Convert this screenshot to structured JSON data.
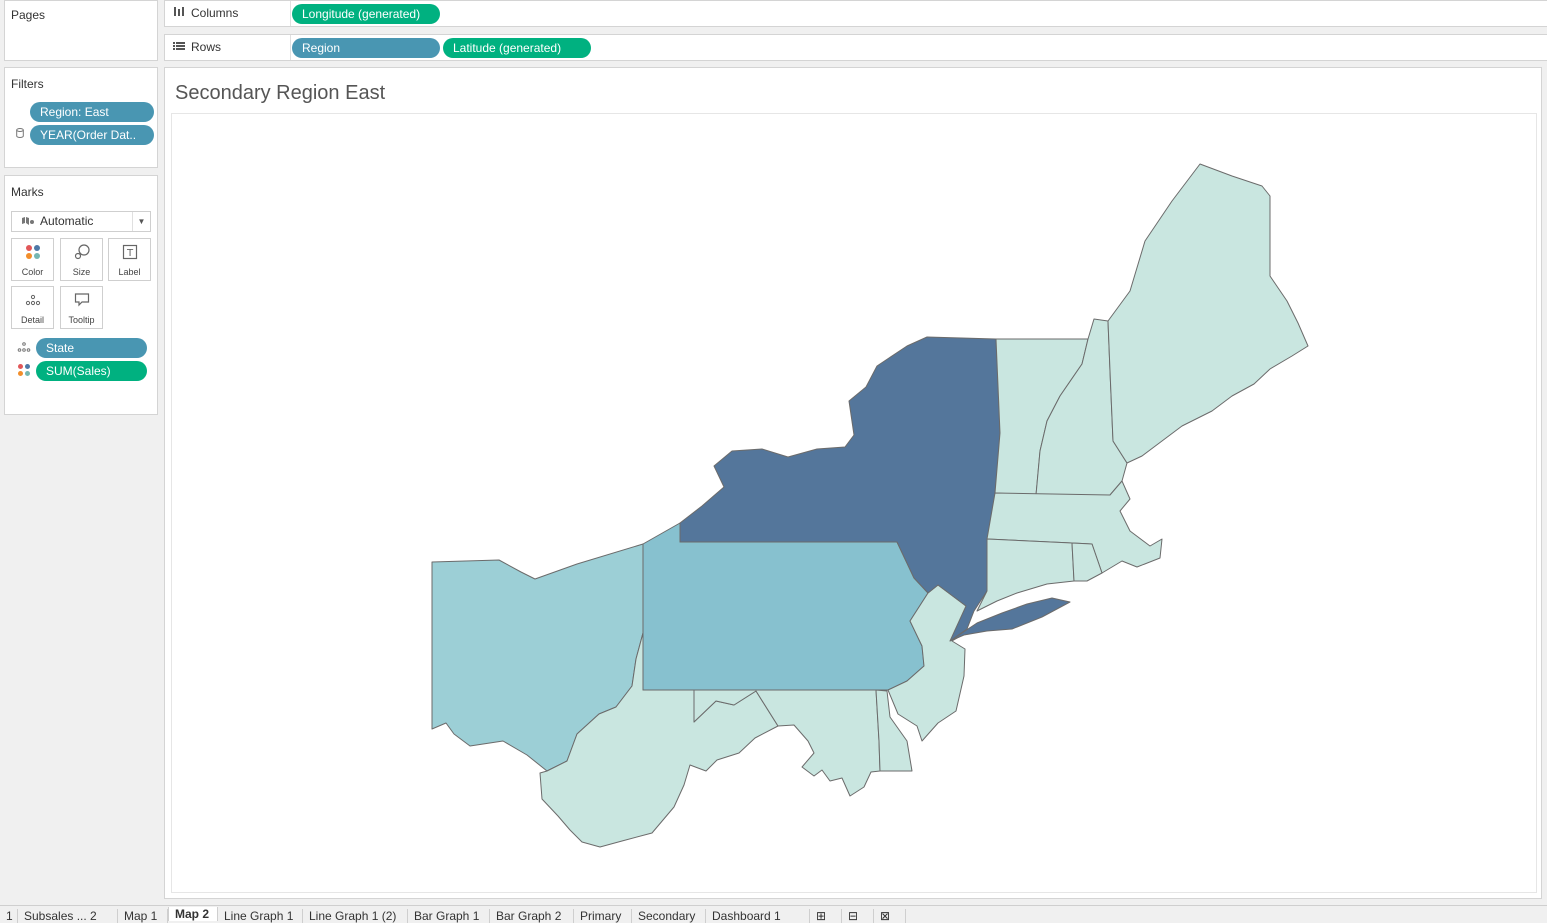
{
  "pages_panel": {
    "title": "Pages"
  },
  "filters_panel": {
    "title": "Filters",
    "items": [
      {
        "label": "Region: East",
        "color": "#4996b2"
      },
      {
        "label": "YEAR(Order Dat..",
        "color": "#4996b2"
      }
    ]
  },
  "marks_panel": {
    "title": "Marks",
    "mark_type": "Automatic",
    "buttons": [
      "Color",
      "Size",
      "Label",
      "Detail",
      "Tooltip"
    ],
    "fields": [
      {
        "label": "State",
        "role": "detail-icon",
        "color": "#4996b2"
      },
      {
        "label": "SUM(Sales)",
        "role": "color-icon",
        "color": "#00b180"
      }
    ]
  },
  "columns_shelf": {
    "label": "Columns",
    "pills": [
      "Longitude (generated)"
    ]
  },
  "rows_shelf": {
    "label": "Rows",
    "pills": [
      "Region",
      "Latitude (generated)"
    ]
  },
  "view": {
    "title": "Secondary Region East"
  },
  "map": {
    "color_scale": {
      "low": "#c9e6e0",
      "mid": "#87c1cf",
      "high": "#54769b"
    },
    "states": [
      {
        "code": "NY",
        "shade": "high"
      },
      {
        "code": "PA",
        "shade": "mid"
      },
      {
        "code": "OH",
        "shade": "mid-low"
      },
      {
        "code": "NJ",
        "shade": "low"
      },
      {
        "code": "WV",
        "shade": "low"
      },
      {
        "code": "MD",
        "shade": "low"
      },
      {
        "code": "DE",
        "shade": "low"
      },
      {
        "code": "VT",
        "shade": "low"
      },
      {
        "code": "NH",
        "shade": "low"
      },
      {
        "code": "ME",
        "shade": "low"
      },
      {
        "code": "MA",
        "shade": "low"
      },
      {
        "code": "CT",
        "shade": "low"
      },
      {
        "code": "RI",
        "shade": "low"
      }
    ]
  },
  "sheet_tabs": [
    {
      "label": "1",
      "active": false
    },
    {
      "label": "Subsales ... 2",
      "active": false
    },
    {
      "label": "Map 1",
      "active": false
    },
    {
      "label": "Map 2",
      "active": true
    },
    {
      "label": "Line Graph 1",
      "active": false
    },
    {
      "label": "Line Graph 1 (2)",
      "active": false
    },
    {
      "label": "Bar Graph 1",
      "active": false
    },
    {
      "label": "Bar Graph 2",
      "active": false
    },
    {
      "label": "Primary",
      "active": false
    },
    {
      "label": "Secondary",
      "active": false
    },
    {
      "label": "Dashboard 1",
      "active": false
    }
  ]
}
